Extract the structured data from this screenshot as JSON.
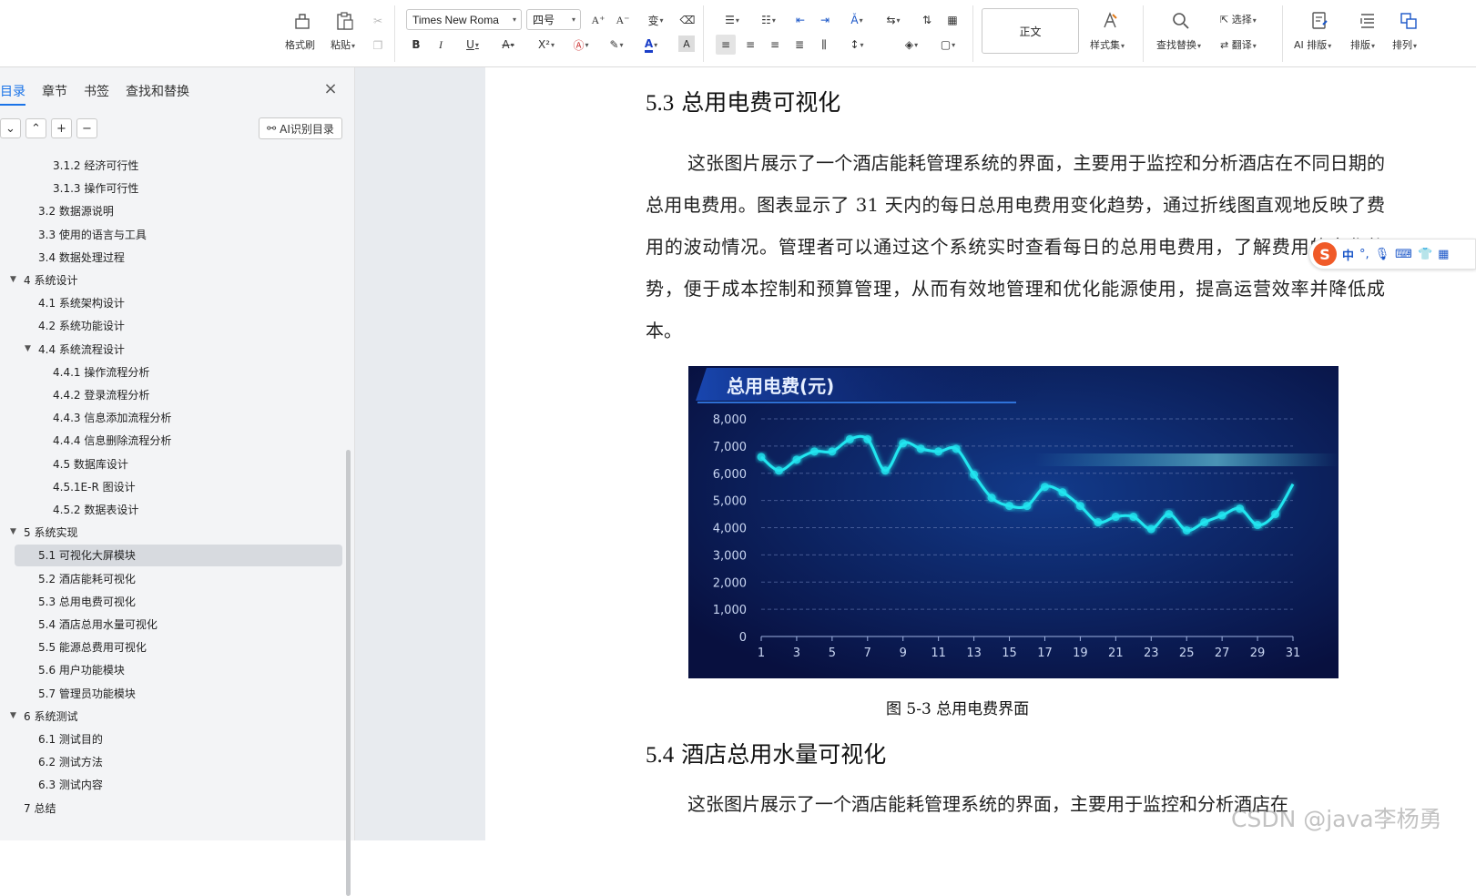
{
  "ribbon": {
    "format_painter": "格式刷",
    "paste": "粘贴",
    "font_name": "Times New Roma",
    "font_size": "四号",
    "style_box": "正文",
    "style_set": "样式集",
    "find_replace": "查找替换",
    "select": "选择",
    "translate": "翻译",
    "ai_layout": "AI 排版",
    "layout": "排版",
    "arrange": "排列",
    "bold": "B",
    "italic": "I",
    "underline": "U",
    "superscript": "X²",
    "char_shade": "A"
  },
  "sidebar": {
    "tabs": [
      "目录",
      "章节",
      "书签",
      "查找和替换"
    ],
    "ai_toc_button": "AI识别目录",
    "toc": [
      {
        "label": "3.1.2  经济可行性",
        "level": 3
      },
      {
        "label": "3.1.3  操作可行性",
        "level": 3
      },
      {
        "label": "3.2 数据源说明",
        "level": 2
      },
      {
        "label": "3.3 使用的语言与工具",
        "level": 2
      },
      {
        "label": "3.4 数据处理过程",
        "level": 2
      },
      {
        "label": "4 系统设计",
        "level": 1,
        "expanded": true
      },
      {
        "label": "4.1 系统架构设计",
        "level": 2
      },
      {
        "label": "4.2 系统功能设计",
        "level": 2
      },
      {
        "label": "4.4 系统流程设计",
        "level": 2,
        "expanded": true
      },
      {
        "label": "4.4.1 操作流程分析",
        "level": 3
      },
      {
        "label": "4.4.2 登录流程分析",
        "level": 3
      },
      {
        "label": "4.4.3 信息添加流程分析",
        "level": 3
      },
      {
        "label": "4.4.4 信息删除流程分析",
        "level": 3
      },
      {
        "label": "4.5 数据库设计",
        "level": 3
      },
      {
        "label": "4.5.1E-R 图设计",
        "level": 3
      },
      {
        "label": "4.5.2 数据表设计",
        "level": 3
      },
      {
        "label": "5 系统实现",
        "level": 1,
        "expanded": true
      },
      {
        "label": "5.1 可视化大屏模块",
        "level": 2,
        "selected": true
      },
      {
        "label": "5.2 酒店能耗可视化",
        "level": 2
      },
      {
        "label": "5.3 总用电费可视化",
        "level": 2
      },
      {
        "label": "5.4 酒店总用水量可视化",
        "level": 2
      },
      {
        "label": "5.5 能源总费用可视化",
        "level": 2
      },
      {
        "label": "5.6 用户功能模块",
        "level": 2
      },
      {
        "label": "5.7 管理员功能模块",
        "level": 2
      },
      {
        "label": "6 系统测试",
        "level": 1,
        "expanded": true
      },
      {
        "label": "6.1 测试目的",
        "level": 2
      },
      {
        "label": "6.2 测试方法",
        "level": 2
      },
      {
        "label": "6.3 测试内容",
        "level": 2
      },
      {
        "label": "7 总结",
        "level": 1
      }
    ]
  },
  "document": {
    "section_53_num": "5.3",
    "section_53_title": "总用电费可视化",
    "para_53": "这张图片展示了一个酒店能耗管理系统的界面，主要用于监控和分析酒店在不同日期的总用电费用。图表显示了 31 天内的每日总用电费用变化趋势，通过折线图直观地反映了费用的波动情况。管理者可以通过这个系统实时查看每日的总用电费用，了解费用的变化趋势，便于成本控制和预算管理，从而有效地管理和优化能源使用，提高运营效率并降低成本。",
    "figure_caption": "图 5-3 总用电费界面",
    "section_54_num": "5.4",
    "section_54_title": "酒店总用水量可视化",
    "para_54": "这张图片展示了一个酒店能耗管理系统的界面，主要用于监控和分析酒店在"
  },
  "chart_data": {
    "type": "line",
    "title": "总用电费(元)",
    "x": [
      1,
      2,
      3,
      4,
      5,
      6,
      7,
      8,
      9,
      10,
      11,
      12,
      13,
      14,
      15,
      16,
      17,
      18,
      19,
      20,
      21,
      22,
      23,
      24,
      25,
      26,
      27,
      28,
      29,
      30,
      31
    ],
    "x_tick_labels": [
      "1",
      "3",
      "5",
      "7",
      "9",
      "11",
      "13",
      "15",
      "17",
      "19",
      "21",
      "23",
      "25",
      "27",
      "29",
      "31"
    ],
    "values": [
      6600,
      6100,
      6500,
      6800,
      6800,
      7250,
      7250,
      6100,
      7100,
      6900,
      6800,
      6900,
      5950,
      5100,
      4800,
      4800,
      5500,
      5300,
      4800,
      4200,
      4400,
      4400,
      3950,
      4500,
      3900,
      4200,
      4450,
      4700,
      4100,
      4500,
      5600
    ],
    "ylim": [
      0,
      8000
    ],
    "y_tick_labels": [
      "0",
      "1,000",
      "2,000",
      "3,000",
      "4,000",
      "5,000",
      "6,000",
      "7,000",
      "8,000"
    ],
    "grid": true,
    "series_color": "#20e6f0",
    "background": "#0a1550"
  },
  "ime": {
    "label": "中"
  },
  "watermark": "CSDN @java李杨勇"
}
